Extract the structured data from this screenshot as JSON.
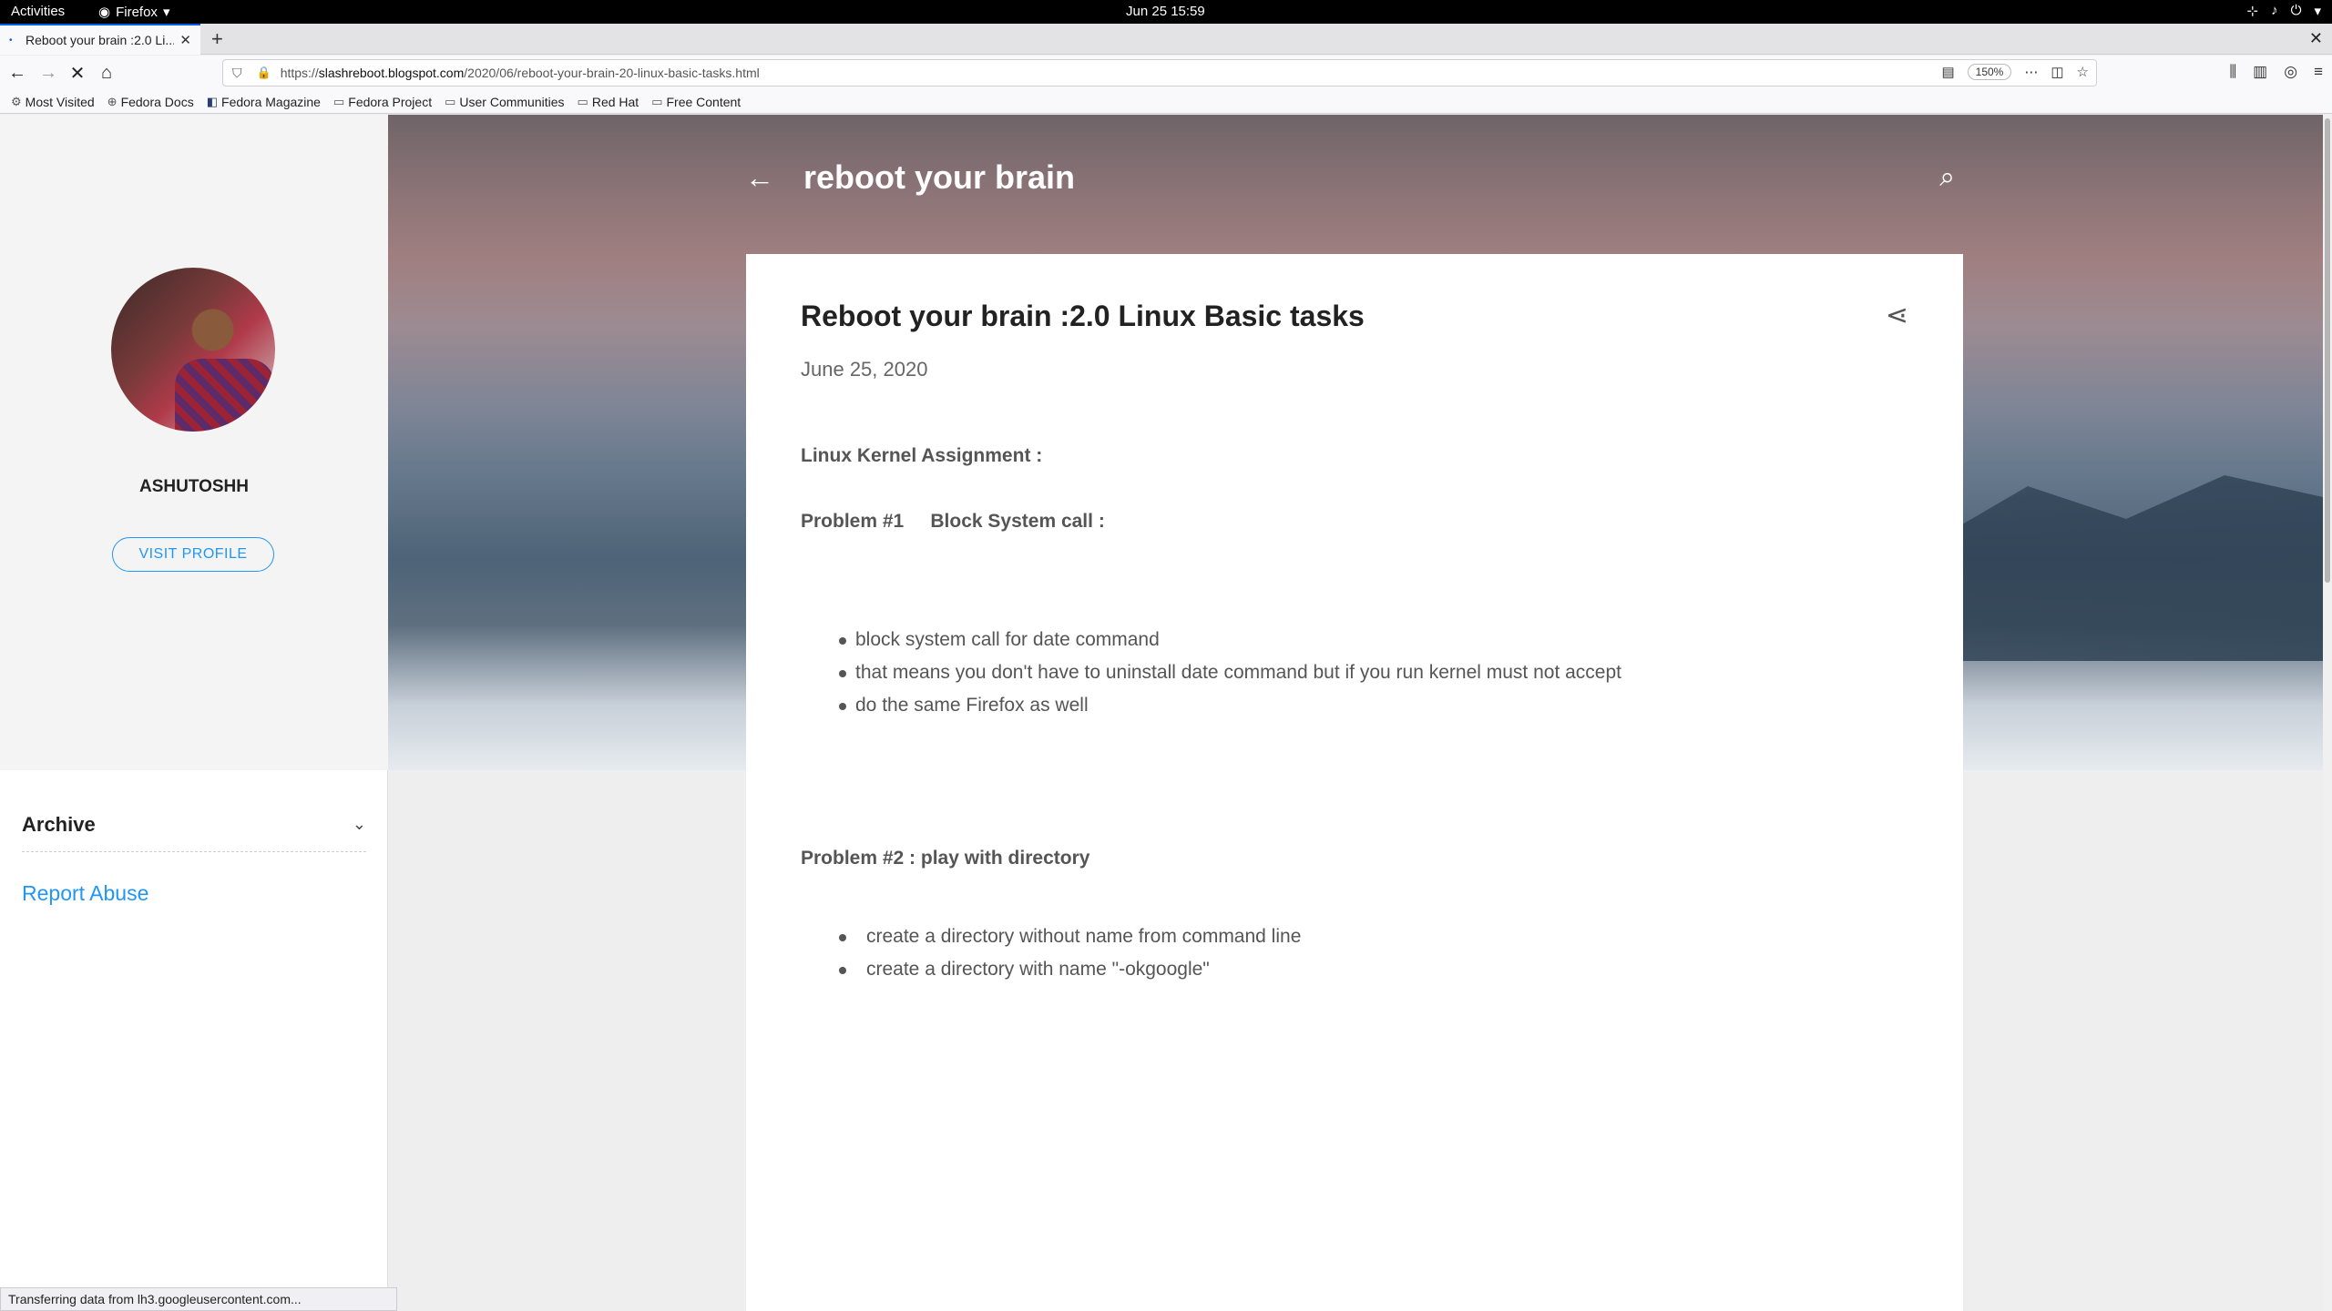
{
  "gnome": {
    "activities": "Activities",
    "app": "Firefox",
    "clock": "Jun 25  15:59"
  },
  "browser": {
    "tab_title": "Reboot your brain :2.0 Li...",
    "url_prefix": "https://",
    "url_host": "slashreboot.blogspot.com",
    "url_path": "/2020/06/reboot-your-brain-20-linux-basic-tasks.html",
    "zoom": "150%",
    "bookmarks": [
      "Most Visited",
      "Fedora Docs",
      "Fedora Magazine",
      "Fedora Project",
      "User Communities",
      "Red Hat",
      "Free Content"
    ],
    "status": "Transferring data from lh3.googleusercontent.com..."
  },
  "sidebar": {
    "profile_name": "ASHUTOSHH",
    "visit_profile": "VISIT PROFILE",
    "archive": "Archive",
    "report_abuse": "Report Abuse"
  },
  "blog": {
    "title": "reboot your brain"
  },
  "post": {
    "title": "Reboot your brain :2.0 Linux Basic tasks",
    "date": "June 25, 2020",
    "heading1": "Linux Kernel Assignment :",
    "heading2": "Problem #1     Block System call :",
    "list1": [
      "block system call for date command",
      "that means you don't have to uninstall date command but if you run kernel must not accept",
      "do the same Firefox as well"
    ],
    "heading3": "Problem #2 :  play with directory",
    "list2": [
      "create a directory without name from command line",
      "create a directory with name \"-okgoogle\""
    ]
  }
}
